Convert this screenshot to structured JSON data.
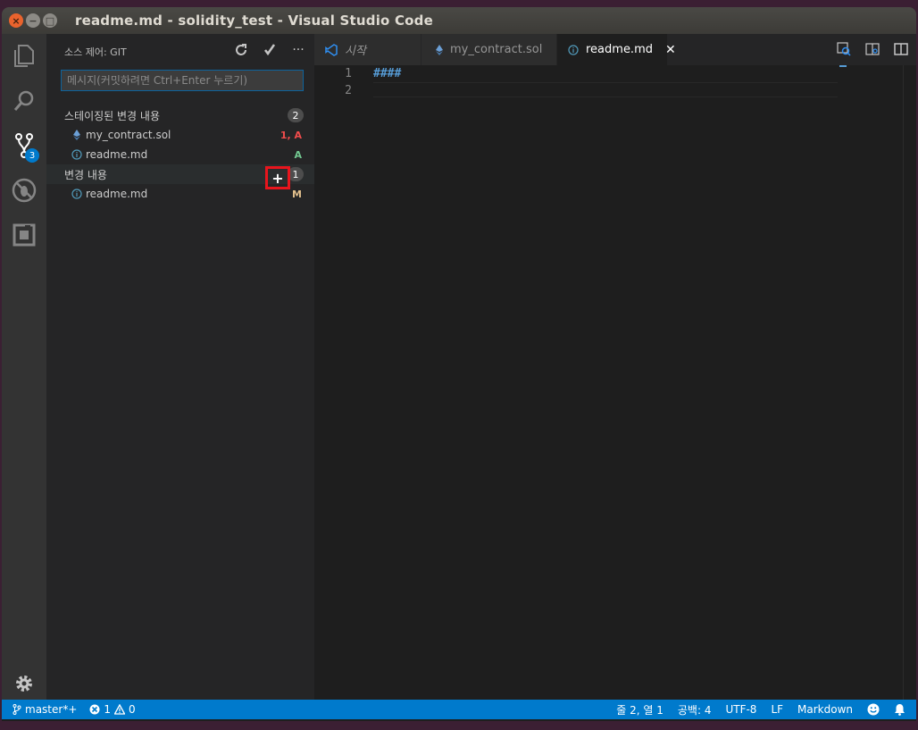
{
  "window": {
    "title": "readme.md - solidity_test - Visual Studio Code",
    "close": "×",
    "minimize": "−",
    "maximize": "□"
  },
  "activity": {
    "scm_badge": "3"
  },
  "sidebar": {
    "header": "소스 제어: GIT",
    "actions": {
      "refresh": "refresh-icon",
      "commit": "check-icon",
      "more": "···"
    },
    "commit_placeholder": "메시지(커밋하려면 Ctrl+Enter 누르기)",
    "staged": {
      "label": "스테이징된 변경 내용",
      "count": "2",
      "files": [
        {
          "name": "my_contract.sol",
          "status": "1, A",
          "status_color": "#f14c4c"
        },
        {
          "name": "readme.md",
          "status": "A",
          "status_color": "#73c991"
        }
      ]
    },
    "changes": {
      "label": "변경 내용",
      "count": "1",
      "stage_button": "+",
      "files": [
        {
          "name": "readme.md",
          "status": "M",
          "status_color": "#e2c08d"
        }
      ]
    }
  },
  "tabs": [
    {
      "label": "시작",
      "icon": "vscode-icon"
    },
    {
      "label": "my_contract.sol",
      "icon": "ethereum-icon"
    },
    {
      "label": "readme.md",
      "icon": "info-icon",
      "close": "✕"
    }
  ],
  "editor": {
    "lines": [
      {
        "number": "1",
        "text": "####"
      },
      {
        "number": "2",
        "text": ""
      }
    ]
  },
  "statusbar": {
    "branch": "master*+",
    "errors": "1",
    "warnings": "0",
    "position": "줄 2, 열 1",
    "indent": "공백: 4",
    "encoding": "UTF-8",
    "eol": "LF",
    "language": "Markdown"
  },
  "colors": {
    "accent": "#007acc",
    "highlight_box": "#e8151d"
  }
}
